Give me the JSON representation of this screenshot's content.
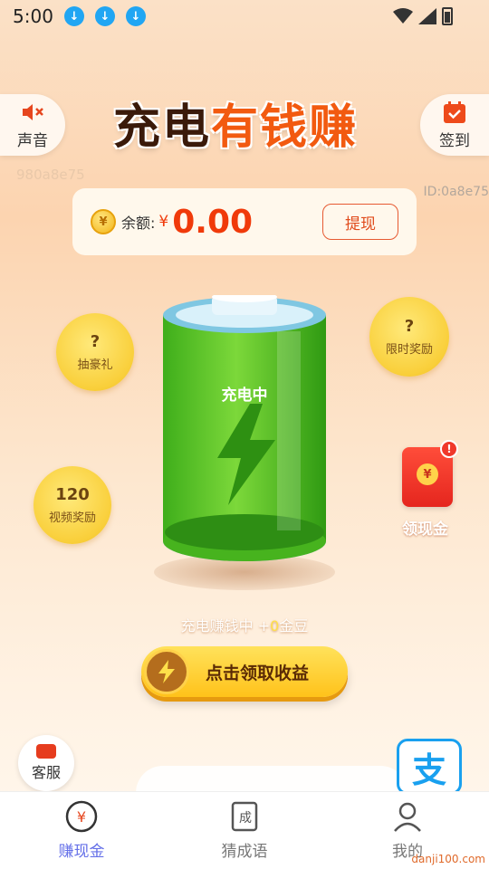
{
  "status_bar": {
    "time": "5:00"
  },
  "header": {
    "title_part1": "充电",
    "title_highlight": "有钱赚",
    "sound_label": "声音",
    "signin_label": "签到",
    "uid_left": "980a8e75",
    "uid_right": "ID:0a8e75"
  },
  "balance": {
    "label": "余额:",
    "currency": "¥",
    "value": "0.00",
    "withdraw_label": "提现",
    "coin_symbol": "¥"
  },
  "bubbles": [
    {
      "top": "?",
      "bottom": "抽豪礼"
    },
    {
      "top": "?",
      "bottom": "限时奖励"
    },
    {
      "top": "120",
      "bottom": "视频奖励"
    }
  ],
  "battery": {
    "status": "充电中"
  },
  "earning": {
    "prefix": "充电赚钱中 +",
    "amount": "0",
    "unit": "金豆"
  },
  "claim_button": {
    "label": "点击领取收益"
  },
  "red_packet": {
    "label": "领现金",
    "badge": "!",
    "seal": "¥"
  },
  "service": {
    "label": "客服"
  },
  "alipay": {
    "glyph": "支"
  },
  "nav": [
    {
      "label": "赚现金",
      "active": true
    },
    {
      "label": "猜成语",
      "active": false
    },
    {
      "label": "我的",
      "active": false
    }
  ],
  "watermark": "danji100.com",
  "colors": {
    "accent": "#f03a0a",
    "nav_active": "#6570e8",
    "bubble": "#f9cf3a"
  }
}
